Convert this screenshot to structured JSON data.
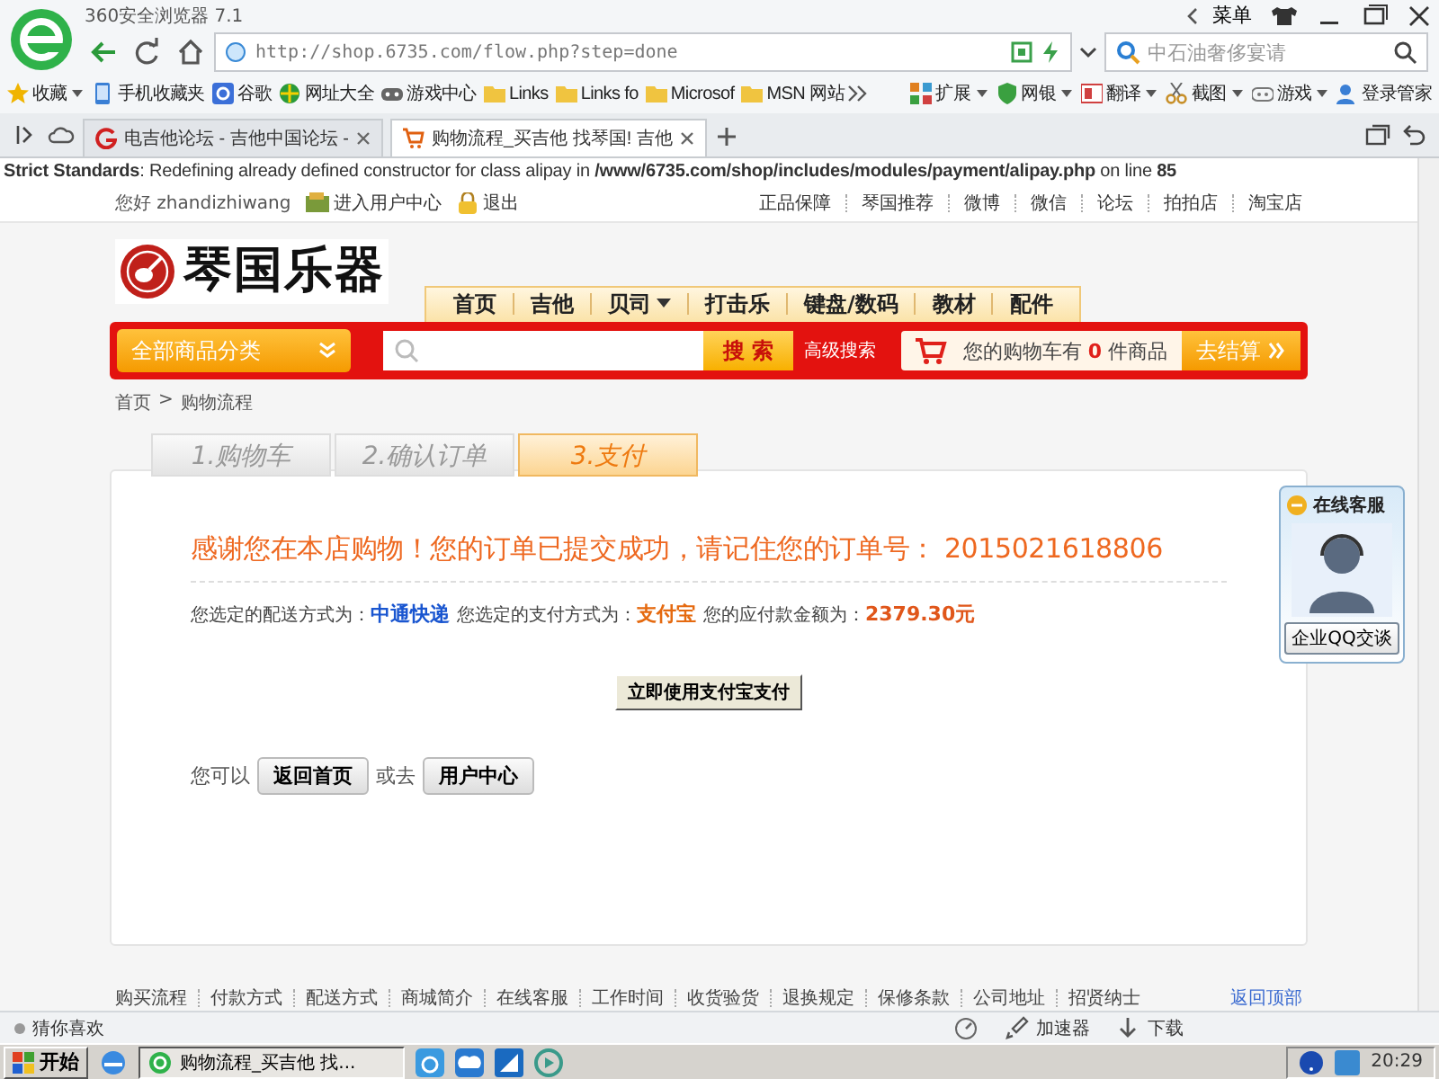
{
  "browser": {
    "title": "360安全浏览器 7.1",
    "menu": "菜单",
    "url": "http://shop.6735.com/flow.php?step=done",
    "search_value": "中石油奢侈宴请",
    "bookmarks": [
      "收藏",
      "手机收藏夹",
      "谷歌",
      "网址大全",
      "游戏中心",
      "Links",
      "Links fo",
      "Microsof",
      "MSN 网站"
    ],
    "tools": [
      "扩展",
      "网银",
      "翻译",
      "截图",
      "游戏",
      "登录管家"
    ],
    "tabs": [
      {
        "label": "电吉他论坛 - 吉他中国论坛 -",
        "selected": false
      },
      {
        "label": "购物流程_买吉他 找琴国! 吉他",
        "selected": true
      }
    ]
  },
  "notice": "**Strict Standards**: Redefining already defined constructor for class alipay in **/www/6735.com/shop/includes/modules/payment/alipay.php** on line **85**",
  "topbar": {
    "greeting": "您好 zhandizhiwang",
    "user_center": "进入用户中心",
    "logout": "退出",
    "links": [
      "正品保障",
      "琴国推荐",
      "微博",
      "微信",
      "论坛",
      "拍拍店",
      "淘宝店"
    ]
  },
  "logo": "琴国乐器",
  "nav": [
    {
      "label": "首页",
      "has_menu": false
    },
    {
      "label": "吉他",
      "has_menu": false
    },
    {
      "label": "贝司",
      "has_menu": true
    },
    {
      "label": "打击乐",
      "has_menu": false
    },
    {
      "label": "键盘/数码",
      "has_menu": false
    },
    {
      "label": "教材",
      "has_menu": false
    },
    {
      "label": "配件",
      "has_menu": false
    }
  ],
  "category_button": "全部商品分类",
  "search_button": "搜 索",
  "advanced_search": "高级搜索",
  "cart": "您的购物车有 **0** 件商品",
  "checkout": "去结算",
  "breadcrumb": {
    "home": "首页",
    "separator": ">",
    "current": "购物流程"
  },
  "steps": [
    {
      "label": "1.购物车",
      "selected": false
    },
    {
      "label": "2.确认订单",
      "selected": false
    },
    {
      "label": "3.支付",
      "selected": true
    }
  ],
  "thanks": "感谢您在本店购物！您的订单已提交成功，请记住您的订单号： 2015021618806",
  "summary": [
    {
      "label": "您选定的配送方式为：",
      "value": "中通快递",
      "color": "#1a56d0"
    },
    {
      "label": "您选定的支付方式为：",
      "value": "支付宝",
      "color": "#e56a10"
    },
    {
      "label": "您的应付款金额为：",
      "value": "2379.30元",
      "color": "#e0561a"
    }
  ],
  "pay_button": "立即使用支付宝支付",
  "next": {
    "prefix": "您可以",
    "home_button": "返回首页",
    "or": "或去",
    "center_button": "用户中心"
  },
  "service": {
    "title": "在线客服",
    "button": "企业QQ交谈"
  },
  "footer_links": [
    "购买流程",
    "付款方式",
    "配送方式",
    "商城简介",
    "在线客服",
    "工作时间",
    "收货验货",
    "退换规定",
    "保修条款",
    "公司地址",
    "招贤纳士"
  ],
  "back_to_top": "返回顶部",
  "status_bar": {
    "left": "猜你喜欢",
    "items": [
      "加速器",
      "下载"
    ]
  },
  "taskbar": {
    "start": "开始",
    "window": "购物流程_买吉他 找...",
    "clock": "20:29"
  }
}
